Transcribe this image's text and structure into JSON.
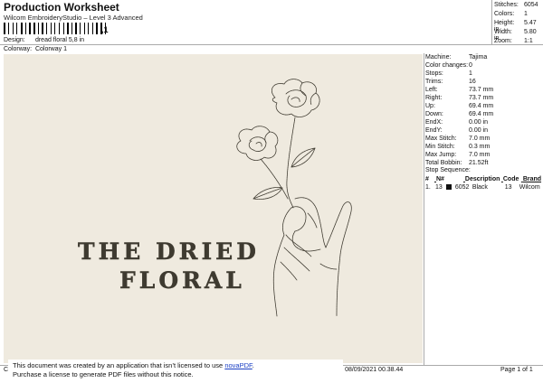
{
  "header": {
    "title": "Production Worksheet",
    "subtitle": "Wilcom EmbroideryStudio – Level 3 Advanced",
    "barcode_suffix": ",1"
  },
  "meta": [
    {
      "key": "Design:",
      "value": "dread floral 5,8 in"
    },
    {
      "key": "Colorway:",
      "value": "Colorway 1"
    }
  ],
  "stats": [
    {
      "key": "Stitches:",
      "value": "6054"
    },
    {
      "key": "Colors:",
      "value": "1"
    },
    {
      "key": "Height:",
      "value": "5.47 in"
    },
    {
      "key": "Width:",
      "value": "5.80 in"
    },
    {
      "key": "Zoom:",
      "value": "1:1"
    }
  ],
  "design": {
    "line1": "THE DRIED",
    "line2": "FLORAL",
    "colors": {
      "canvas": "#efeadf",
      "thread": "#3e3a30"
    }
  },
  "specs": [
    {
      "key": "Machine:",
      "value": "Tajima"
    },
    {
      "key": "Color changes:",
      "value": "0"
    },
    {
      "key": "Stops:",
      "value": "1"
    },
    {
      "key": "Trims:",
      "value": "16"
    },
    {
      "key": "Left:",
      "value": "73.7 mm"
    },
    {
      "key": "Right:",
      "value": "73.7 mm"
    },
    {
      "key": "Up:",
      "value": "69.4 mm"
    },
    {
      "key": "Down:",
      "value": "69.4 mm"
    },
    {
      "key": "EndX:",
      "value": "0.00 in"
    },
    {
      "key": "EndY:",
      "value": "0.00 in"
    },
    {
      "key": "Max Stitch:",
      "value": "7.0 mm"
    },
    {
      "key": "Min Stitch:",
      "value": "0.3 mm"
    },
    {
      "key": "Max Jump:",
      "value": "7.0 mm"
    },
    {
      "key": "Total Bobbin:",
      "value": "21.52ft"
    }
  ],
  "sequence": {
    "heading": "Stop Sequence:",
    "columns": [
      "#",
      "N#",
      "Description",
      "Code",
      "Brand"
    ],
    "rows": [
      {
        "num": "1.",
        "n": "13",
        "n2": "6052",
        "description": "Black",
        "code": "13",
        "brand": "Wilcom",
        "swatch": "#111111"
      }
    ]
  },
  "footer": {
    "left": "Cr",
    "printed": "Printed: 08/09/2021 00.38.44",
    "page": "Page 1 of 1"
  },
  "notice": {
    "line1_prefix": "This document was created by an application that isn’t licensed to use ",
    "link": "novaPDF",
    "line1_suffix": ".",
    "line2": "Purchase a license to generate PDF files without this notice."
  }
}
